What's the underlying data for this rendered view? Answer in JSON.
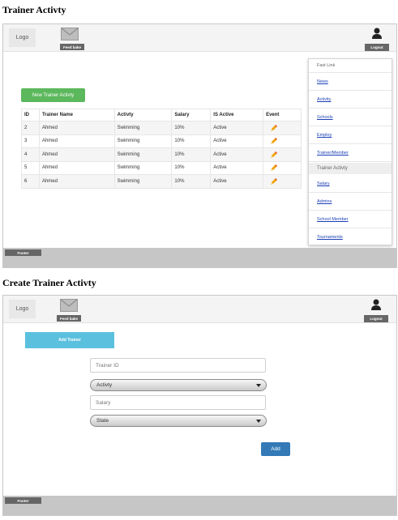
{
  "list_page": {
    "section_title": "Trainer Activty",
    "header": {
      "logo": "Logo",
      "feedback_label": "Feed bake",
      "logout_label": "Logout"
    },
    "new_button": "New Trainer Activty",
    "table": {
      "columns": [
        "ID",
        "Trainer Name",
        "Activty",
        "Salary",
        "IS Active",
        "Event"
      ],
      "rows": [
        {
          "id": "2",
          "name": "Ahmed",
          "activity": "Swimming",
          "salary": "10%",
          "status": "Active"
        },
        {
          "id": "3",
          "name": "Ahmed",
          "activity": "Swimming",
          "salary": "10%",
          "status": "Active"
        },
        {
          "id": "4",
          "name": "Ahmed",
          "activity": "Swimming",
          "salary": "10%",
          "status": "Active"
        },
        {
          "id": "5",
          "name": "Ahmed",
          "activity": "Swimming",
          "salary": "10%",
          "status": "Active"
        },
        {
          "id": "6",
          "name": "Ahmed",
          "activity": "Swimming",
          "salary": "10%",
          "status": "Active"
        }
      ],
      "event_icon": "pencil-icon"
    },
    "fast_links": {
      "title": "Fast Link",
      "group1": [
        "News",
        "Activity",
        "Schools",
        "Employ",
        "Trainer/Member"
      ],
      "group2_title": "Trainer Activty",
      "group2": [
        "Salary",
        "Admins",
        "School Member",
        "Tournaments"
      ]
    },
    "footer": "Footer"
  },
  "create_page": {
    "section_title": "Create Trainer Activty",
    "header": {
      "logo": "Logo",
      "feedback_label": "Feed bake",
      "logout_label": "Logout"
    },
    "add_trainer_button": "Add Trainer",
    "trainer_id_placeholder": "Trainer ID",
    "activity_select": "Activty",
    "salary_placeholder": "Salary",
    "state_select": "State",
    "add_button": "Add",
    "footer": "Footer"
  },
  "colors": {
    "green_button": "#5cb85c",
    "light_blue_button": "#5bc0de",
    "blue_button": "#337ab7",
    "link": "#1a3fb5"
  },
  "icons": [
    "envelope-icon",
    "user-icon",
    "pencil-icon",
    "caret-down-icon"
  ]
}
